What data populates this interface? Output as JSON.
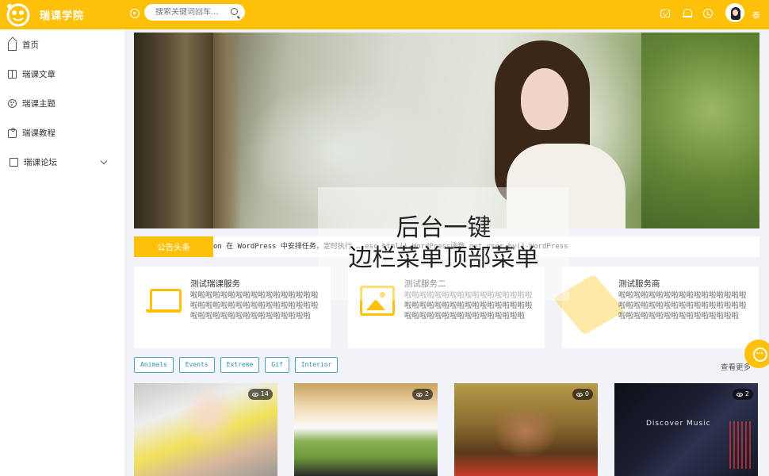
{
  "header": {
    "brand": "瑞课学院",
    "search_placeholder": "搜索关键词回车...",
    "username": "泰",
    "icons": [
      "logo-icon",
      "toggle-icon",
      "search-icon",
      "mail-icon",
      "bell-icon",
      "history-icon",
      "avatar"
    ],
    "accent_color": "#ffc107"
  },
  "sidebar": {
    "items": [
      {
        "label": "首页",
        "icon": "home-icon"
      },
      {
        "label": "瑞课文章",
        "icon": "book-icon"
      },
      {
        "label": "瑞课主题",
        "icon": "palette-icon"
      },
      {
        "label": "瑞课教程",
        "icon": "video-icon"
      },
      {
        "label": "瑞课论坛",
        "icon": "phone-icon",
        "has_submenu": true
      }
    ]
  },
  "overlay": {
    "line1": "后台一键",
    "line2": "边栏菜单顶部菜单"
  },
  "announcement": {
    "label": "公告头条",
    "text": "on 在 WordPress 中安排任务，定时执行   …   esc_html()-WordPress函数    get_user_by()-WordPress"
  },
  "services": [
    {
      "title": "测试瑞课服务",
      "desc": "啦啦啦啦啦啦啦啦啦啦啦啦啦啦啦啦啦啦啦啦啦啦啦啦啦啦啦啦啦啦啦啦啦啦啦啦啦啦啦啦啦啦啦啦啦啦啦啦啦啦",
      "icon": "laptop-icon"
    },
    {
      "title": "测试服务二",
      "desc": "啦啦啦啦啦啦啦啦啦啦啦啦啦啦啦啦啦啦啦啦啦啦啦啦啦啦啦啦啦啦啦啦啦啦啦啦啦啦啦啦啦啦啦啦啦啦啦啦啦啦",
      "icon": "image-icon"
    },
    {
      "title": "测试服务商",
      "desc": "啦啦啦啦啦啦啦啦啦啦啦啦啦啦啦啦啦啦啦啦啦啦啦啦啦啦啦啦啦啦啦啦啦啦啦啦啦啦啦啦啦啦啦啦啦啦啦啦啦啦",
      "icon": "layers-icon"
    }
  ],
  "tags": [
    "Animals",
    "Events",
    "Extreme",
    "Gif",
    "Interior"
  ],
  "more_label": "查看更多",
  "posts": [
    {
      "views": "14"
    },
    {
      "views": "2"
    },
    {
      "views": "0"
    },
    {
      "views": "2",
      "overlay_text": "Discover Music"
    }
  ]
}
